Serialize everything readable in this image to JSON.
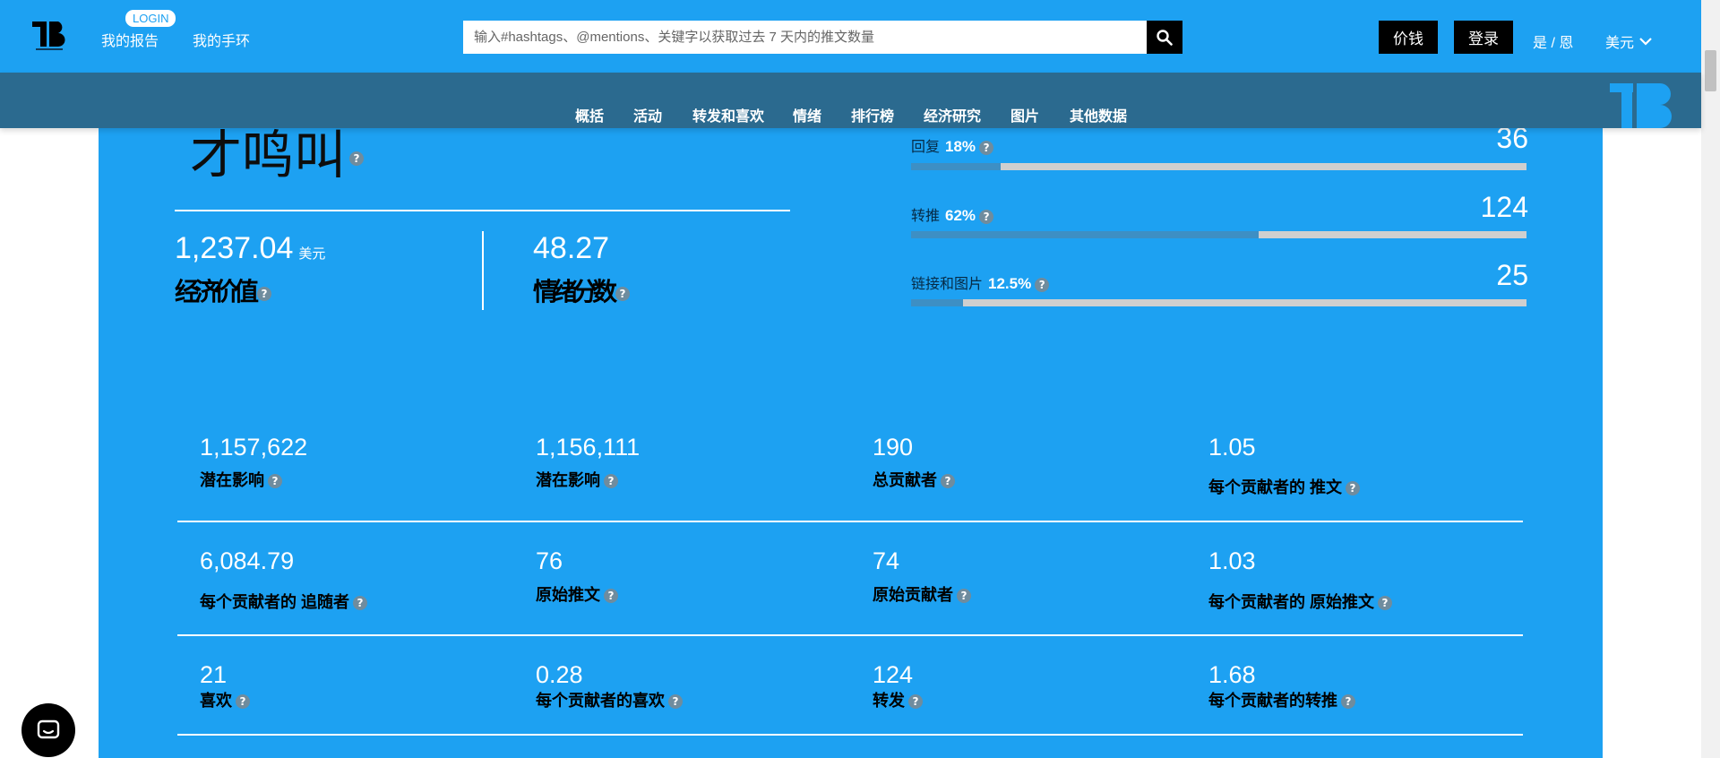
{
  "header": {
    "login_badge": "LOGIN",
    "my_reports": "我的报告",
    "my_app": "我的手环",
    "search_placeholder": "输入#hashtags、@mentions、关键字以获取过去 7 天内的推文数量",
    "pricing": "价钱",
    "login": "登录",
    "lang": "是 / 恩",
    "currency": "美元"
  },
  "subnav": [
    "概括",
    "活动",
    "转发和喜欢",
    "情绪",
    "排行榜",
    "经济研究",
    "图片",
    "其他数据"
  ],
  "summary": {
    "title": "才鸣叫",
    "value_usd": "1,237.04",
    "usd_unit": "美元",
    "value_label": "经济价值",
    "score": "48.27",
    "score_label": "情绪分数"
  },
  "bars": [
    {
      "label": "回复",
      "percent": "18%",
      "count": "36",
      "fraction": 0.145
    },
    {
      "label": "转推",
      "percent": "62%",
      "count": "124",
      "fraction": 0.565
    },
    {
      "label": "链接和图片",
      "percent": "12.5%",
      "count": "25",
      "fraction": 0.085
    }
  ],
  "stats": [
    [
      {
        "value": "1,157,622",
        "label": "潜在影响"
      },
      {
        "value": "1,156,111",
        "label": "潜在影响"
      },
      {
        "value": "190",
        "label": "总贡献者"
      },
      {
        "value": "1.05",
        "label": "每个贡献者的 推文"
      }
    ],
    [
      {
        "value": "6,084.79",
        "label": "每个贡献者的 追随者"
      },
      {
        "value": "76",
        "label": "原始推文"
      },
      {
        "value": "74",
        "label": "原始贡献者"
      },
      {
        "value": "1.03",
        "label": "每个贡献者的 原始推文"
      }
    ],
    [
      {
        "value": "21",
        "label": "喜欢"
      },
      {
        "value": "0.28",
        "label": "每个贡献者的喜欢"
      },
      {
        "value": "124",
        "label": "转发"
      },
      {
        "value": "1.68",
        "label": "每个贡献者的转推"
      }
    ]
  ],
  "help_glyph": "?",
  "colors": {
    "brand_blue": "#1da1f2",
    "subnav": "#2b6a8f",
    "bar_fill": "#3d8fc4"
  }
}
